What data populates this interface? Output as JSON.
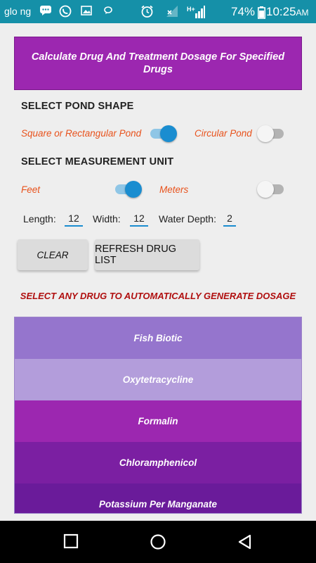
{
  "status_bar": {
    "carrier": "glo ng",
    "battery": "74%",
    "time": "10:25",
    "ampm": "AM"
  },
  "header": {
    "title": "Calculate Drug And Treatment Dosage For Specified Drugs"
  },
  "pond_shape": {
    "heading": "SELECT POND SHAPE",
    "option_a": "Square or Rectangular Pond",
    "option_a_on": true,
    "option_b": "Circular Pond",
    "option_b_on": false
  },
  "unit": {
    "heading": "SELECT MEASUREMENT UNIT",
    "option_a": "Feet",
    "option_a_on": true,
    "option_b": "Meters",
    "option_b_on": false
  },
  "dimensions": {
    "length_label": "Length:",
    "length_value": "12",
    "width_label": "Width:",
    "width_value": "12",
    "depth_label": "Water Depth:",
    "depth_value": "2"
  },
  "buttons": {
    "clear": "CLEAR",
    "refresh": "REFRESH DRUG LIST"
  },
  "hint": "SELECT ANY DRUG TO AUTOMATICALLY GENERATE DOSAGE",
  "drugs": [
    {
      "name": "Fish Biotic",
      "color": "#9575cd"
    },
    {
      "name": "Oxytetracycline",
      "color": "#b39ddb"
    },
    {
      "name": "Formalin",
      "color": "#9c27b0"
    },
    {
      "name": "Chloramphenicol",
      "color": "#7b1fa2"
    },
    {
      "name": "Potassium Per Manganate",
      "color": "#6a1b9a"
    }
  ],
  "colors": {
    "status_bar": "#1590a8",
    "accent": "#1a8dd0",
    "banner": "#9c27b0",
    "option_text": "#e8521c",
    "hint_text": "#b00f0f"
  }
}
